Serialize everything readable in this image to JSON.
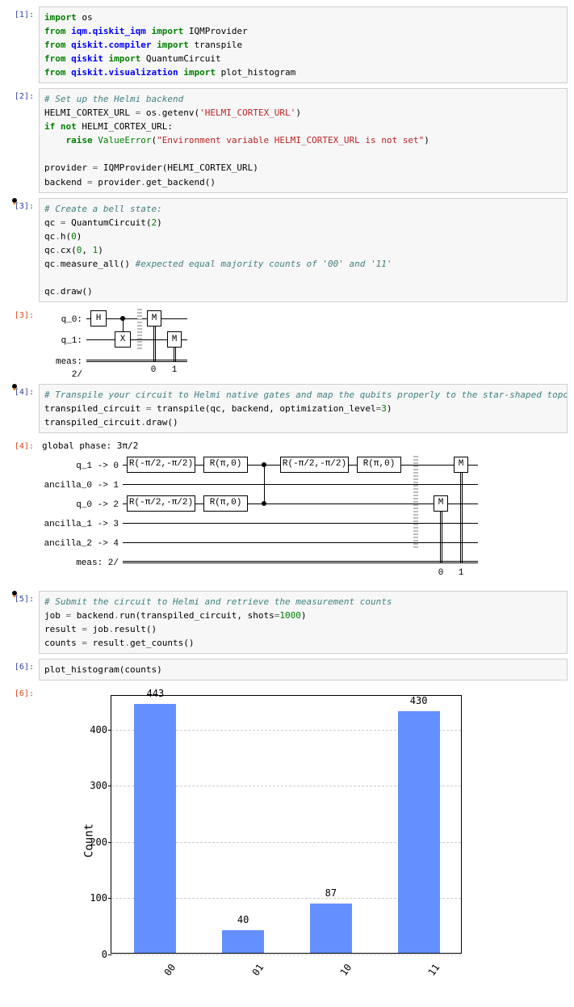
{
  "cells": {
    "c1": {
      "prompt": "[1]:",
      "tokens": [
        {
          "t": "import",
          "c": "kw"
        },
        {
          "t": " os\n"
        },
        {
          "t": "from",
          "c": "kw"
        },
        {
          "t": " "
        },
        {
          "t": "iqm.qiskit_iqm",
          "c": "nn"
        },
        {
          "t": " "
        },
        {
          "t": "import",
          "c": "kw"
        },
        {
          "t": " IQMProvider\n"
        },
        {
          "t": "from",
          "c": "kw"
        },
        {
          "t": " "
        },
        {
          "t": "qiskit.compiler",
          "c": "nn"
        },
        {
          "t": " "
        },
        {
          "t": "import",
          "c": "kw"
        },
        {
          "t": " transpile\n"
        },
        {
          "t": "from",
          "c": "kw"
        },
        {
          "t": " "
        },
        {
          "t": "qiskit",
          "c": "nn"
        },
        {
          "t": " "
        },
        {
          "t": "import",
          "c": "kw"
        },
        {
          "t": " QuantumCircuit\n"
        },
        {
          "t": "from",
          "c": "kw"
        },
        {
          "t": " "
        },
        {
          "t": "qiskit.visualization",
          "c": "nn"
        },
        {
          "t": " "
        },
        {
          "t": "import",
          "c": "kw"
        },
        {
          "t": " plot_histogram"
        }
      ]
    },
    "c2": {
      "prompt": "[2]:",
      "tokens": [
        {
          "t": "# Set up the Helmi backend",
          "c": "cm"
        },
        {
          "t": "\n"
        },
        {
          "t": "HELMI_CORTEX_URL "
        },
        {
          "t": "=",
          "c": "op"
        },
        {
          "t": " os"
        },
        {
          "t": ".",
          "c": "op"
        },
        {
          "t": "getenv"
        },
        {
          "t": "("
        },
        {
          "t": "'HELMI_CORTEX_URL'",
          "c": "str"
        },
        {
          "t": ")\n"
        },
        {
          "t": "if",
          "c": "kw"
        },
        {
          "t": " "
        },
        {
          "t": "not",
          "c": "kw"
        },
        {
          "t": " HELMI_CORTEX_URL:\n"
        },
        {
          "t": "    "
        },
        {
          "t": "raise",
          "c": "kw"
        },
        {
          "t": " "
        },
        {
          "t": "ValueError",
          "c": "bi"
        },
        {
          "t": "("
        },
        {
          "t": "\"Environment variable HELMI_CORTEX_URL is not set\"",
          "c": "str"
        },
        {
          "t": ")\n\n"
        },
        {
          "t": "provider "
        },
        {
          "t": "=",
          "c": "op"
        },
        {
          "t": " IQMProvider(HELMI_CORTEX_URL)\n"
        },
        {
          "t": "backend "
        },
        {
          "t": "=",
          "c": "op"
        },
        {
          "t": " provider"
        },
        {
          "t": ".",
          "c": "op"
        },
        {
          "t": "get_backend()"
        }
      ]
    },
    "c3": {
      "prompt": "[3]:",
      "mod": true,
      "tokens": [
        {
          "t": "# Create a bell state:",
          "c": "cm"
        },
        {
          "t": "\n"
        },
        {
          "t": "qc "
        },
        {
          "t": "=",
          "c": "op"
        },
        {
          "t": " QuantumCircuit("
        },
        {
          "t": "2",
          "c": "num"
        },
        {
          "t": ")\n"
        },
        {
          "t": "qc"
        },
        {
          "t": ".",
          "c": "op"
        },
        {
          "t": "h("
        },
        {
          "t": "0",
          "c": "num"
        },
        {
          "t": ")\n"
        },
        {
          "t": "qc"
        },
        {
          "t": ".",
          "c": "op"
        },
        {
          "t": "cx("
        },
        {
          "t": "0",
          "c": "num"
        },
        {
          "t": ", "
        },
        {
          "t": "1",
          "c": "num"
        },
        {
          "t": ")\n"
        },
        {
          "t": "qc"
        },
        {
          "t": ".",
          "c": "op"
        },
        {
          "t": "measure_all() "
        },
        {
          "t": "#expected equal majority counts of '00' and '11'",
          "c": "cm"
        },
        {
          "t": "\n\n"
        },
        {
          "t": "qc"
        },
        {
          "t": ".",
          "c": "op"
        },
        {
          "t": "draw()"
        }
      ]
    },
    "o3": {
      "prompt": "[3]:"
    },
    "c4": {
      "prompt": "[4]:",
      "mod": true,
      "tokens": [
        {
          "t": "# Transpile your circuit to Helmi native gates and map the qubits properly to the star-shaped topology",
          "c": "cm"
        },
        {
          "t": "\n"
        },
        {
          "t": "transpiled_circuit "
        },
        {
          "t": "=",
          "c": "op"
        },
        {
          "t": " transpile(qc, backend, optimization_level"
        },
        {
          "t": "=",
          "c": "op"
        },
        {
          "t": "3",
          "c": "num"
        },
        {
          "t": ")\n"
        },
        {
          "t": "transpiled_circuit"
        },
        {
          "t": ".",
          "c": "op"
        },
        {
          "t": "draw()"
        }
      ]
    },
    "o4": {
      "prompt": "[4]:",
      "phase": "global phase: 3π/2",
      "labels": [
        "q_1 -> 0",
        "ancilla_0 -> 1",
        "q_0 -> 2",
        "ancilla_1 -> 3",
        "ancilla_2 -> 4",
        "meas: 2/"
      ],
      "gates": [
        "R(-π/2,-π/2)",
        "R(π,0)",
        "R(-π/2,-π/2)",
        "R(π,0)",
        "R(-π/2,-π/2)",
        "R(π,0)",
        "M",
        "M"
      ],
      "idx": [
        "0",
        "1"
      ]
    },
    "c5": {
      "prompt": "[5]:",
      "mod": true,
      "tokens": [
        {
          "t": "# Submit the circuit to Helmi and retrieve the measurement counts",
          "c": "cm"
        },
        {
          "t": "\n"
        },
        {
          "t": "job "
        },
        {
          "t": "=",
          "c": "op"
        },
        {
          "t": " backend"
        },
        {
          "t": ".",
          "c": "op"
        },
        {
          "t": "run(transpiled_circuit, shots"
        },
        {
          "t": "=",
          "c": "op"
        },
        {
          "t": "1000",
          "c": "num"
        },
        {
          "t": ")\n"
        },
        {
          "t": "result "
        },
        {
          "t": "=",
          "c": "op"
        },
        {
          "t": " job"
        },
        {
          "t": ".",
          "c": "op"
        },
        {
          "t": "result()\n"
        },
        {
          "t": "counts "
        },
        {
          "t": "=",
          "c": "op"
        },
        {
          "t": " result"
        },
        {
          "t": ".",
          "c": "op"
        },
        {
          "t": "get_counts()"
        }
      ]
    },
    "c6": {
      "prompt": "[6]:",
      "tokens": [
        {
          "t": "plot_histogram(counts)"
        }
      ]
    },
    "o6": {
      "prompt": "[6]:"
    }
  },
  "circ1": {
    "labels": [
      "q_0:",
      "q_1:",
      "meas: 2/"
    ],
    "gates": [
      "H",
      "X",
      "M",
      "M"
    ],
    "idx": [
      "0",
      "1"
    ]
  },
  "chart_data": {
    "type": "bar",
    "categories": [
      "00",
      "01",
      "10",
      "11"
    ],
    "values": [
      443,
      40,
      87,
      430
    ],
    "ylabel": "Count",
    "yticks": [
      0,
      100,
      200,
      300,
      400
    ],
    "ylim": [
      0,
      460
    ]
  }
}
